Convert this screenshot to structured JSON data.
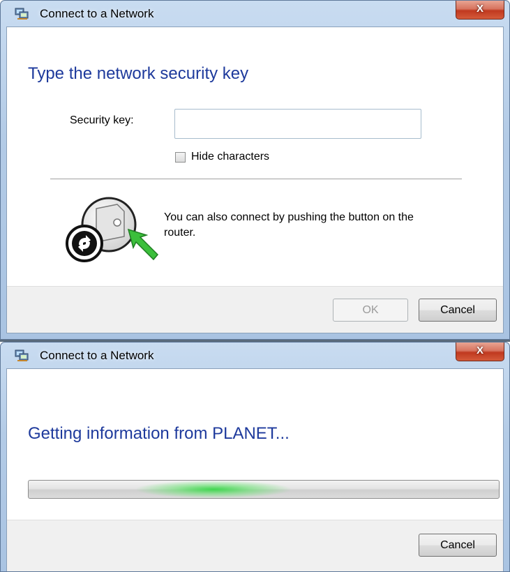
{
  "dialog1": {
    "title": "Connect to a Network",
    "close_label": "X",
    "heading": "Type the network security key",
    "security_key_label": "Security key:",
    "security_key_value": "",
    "hide_characters_label": "Hide characters",
    "hide_characters_checked": false,
    "wps_text": "You can also connect by pushing the button on the router.",
    "ok_label": "OK",
    "ok_enabled": false,
    "cancel_label": "Cancel"
  },
  "dialog2": {
    "title": "Connect to a Network",
    "close_label": "X",
    "heading": "Getting information from PLANET...",
    "progress_state": "indeterminate",
    "cancel_label": "Cancel"
  },
  "colors": {
    "heading": "#1e3a9c",
    "progress_glow": "#38d648",
    "close_button": "#c0391f"
  },
  "icons": {
    "title_icon": "network-icon",
    "wps_icon": "wps-router-icon"
  }
}
